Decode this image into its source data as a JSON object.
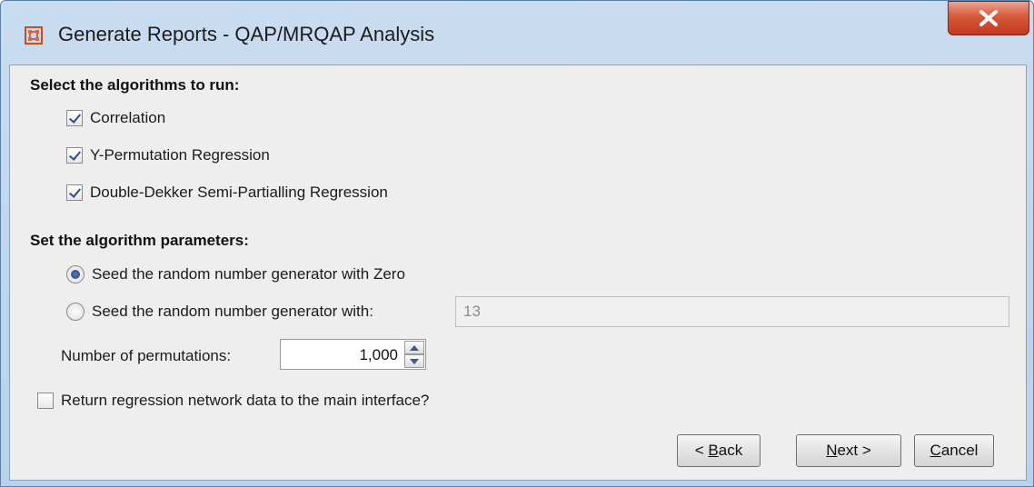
{
  "window": {
    "title": "Generate Reports - QAP/MRQAP Analysis",
    "icon": "app-grid-icon",
    "close_icon": "close-icon",
    "accent": "#c03a1c"
  },
  "algorithms": {
    "heading": "Select the algorithms to run:",
    "items": [
      {
        "label": "Correlation",
        "checked": true
      },
      {
        "label": "Y-Permutation Regression",
        "checked": true
      },
      {
        "label": "Double-Dekker Semi-Partialling Regression",
        "checked": true
      }
    ]
  },
  "parameters": {
    "heading": "Set the algorithm parameters:",
    "seed_zero_label": "Seed the random number generator with Zero",
    "seed_value_label": "Seed the random number generator with:",
    "seed_value": "13",
    "selected_option": "seed_zero",
    "permutations_label": "Number of permutations:",
    "permutations_value": "1,000"
  },
  "return_option": {
    "label": "Return regression network data to the main interface?",
    "checked": false
  },
  "buttons": {
    "back_prefix": "< ",
    "back_mnemonic": "B",
    "back_rest": "ack",
    "next_mnemonic": "N",
    "next_rest": "ext >",
    "cancel_mnemonic": "C",
    "cancel_rest": "ancel"
  }
}
